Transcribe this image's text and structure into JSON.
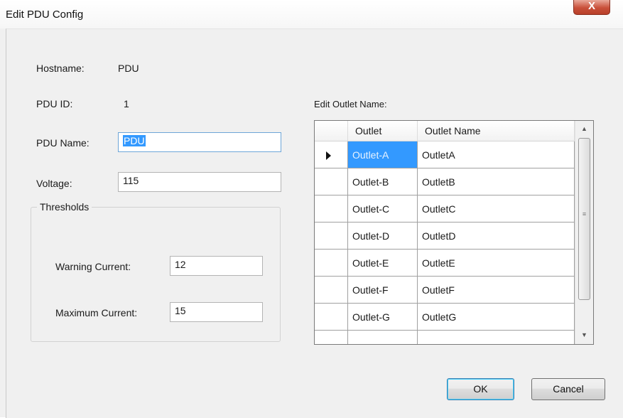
{
  "window": {
    "title": "Edit PDU Config",
    "close_glyph": "X"
  },
  "form": {
    "hostname_label": "Hostname:",
    "hostname_value": "PDU",
    "pduid_label": "PDU ID:",
    "pduid_value": "1",
    "pduname_label": "PDU Name:",
    "pduname_value": "PDU",
    "voltage_label": "Voltage:",
    "voltage_value": "115"
  },
  "thresholds": {
    "title": "Thresholds",
    "warning_label": "Warning Current:",
    "warning_value": "12",
    "maximum_label": "Maximum Current:",
    "maximum_value": "15"
  },
  "outlets": {
    "title": "Edit Outlet Name:",
    "columns": [
      "Outlet",
      "Outlet Name"
    ],
    "rows": [
      [
        "Outlet-A",
        "OutletA"
      ],
      [
        "Outlet-B",
        "OutletB"
      ],
      [
        "Outlet-C",
        "OutletC"
      ],
      [
        "Outlet-D",
        "OutletD"
      ],
      [
        "Outlet-E",
        "OutletE"
      ],
      [
        "Outlet-F",
        "OutletF"
      ],
      [
        "Outlet-G",
        "OutletG"
      ],
      [
        "",
        ""
      ]
    ],
    "selected_row": 0
  },
  "buttons": {
    "ok": "OK",
    "cancel": "Cancel"
  }
}
